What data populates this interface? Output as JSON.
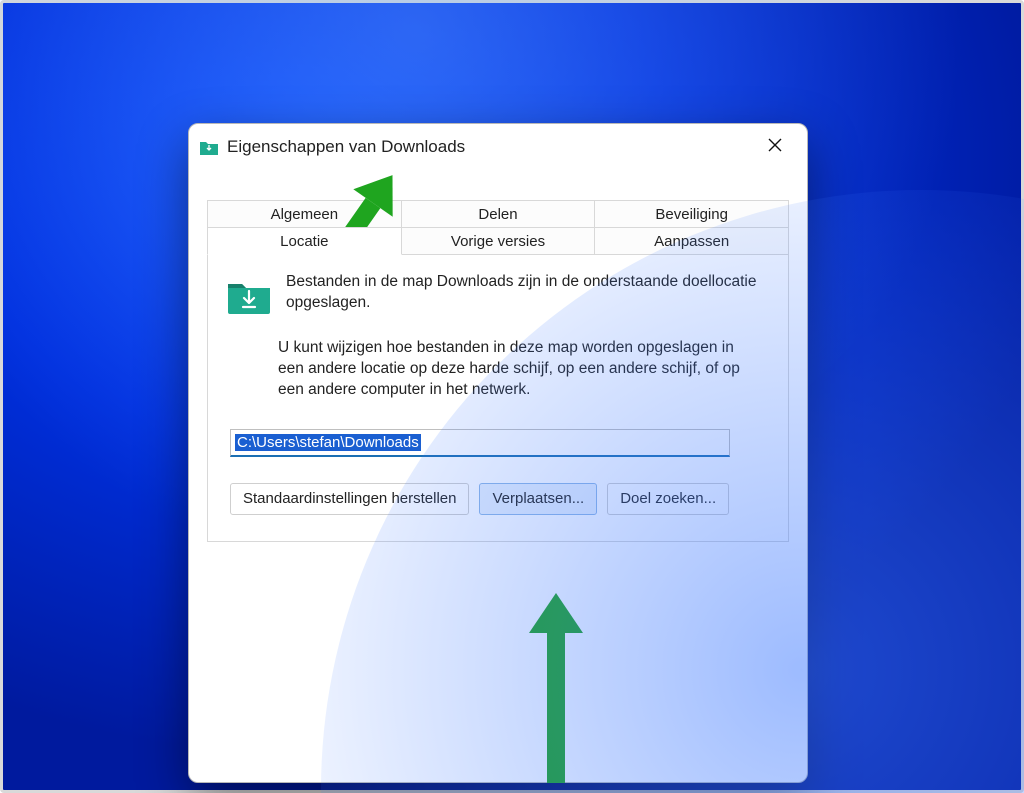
{
  "window": {
    "title": "Eigenschappen van Downloads"
  },
  "tabs": {
    "row1": [
      "Algemeen",
      "Delen",
      "Beveiliging"
    ],
    "row2": [
      "Locatie",
      "Vorige versies",
      "Aanpassen"
    ],
    "active": "Locatie"
  },
  "content": {
    "description": "Bestanden in de map Downloads zijn in de onderstaande doellocatie opgeslagen.",
    "help": "U kunt wijzigen hoe bestanden in deze map worden opgeslagen in een andere locatie op deze harde schijf, op een andere schijf, of op een andere computer in het netwerk.",
    "path": "C:\\Users\\stefan\\Downloads"
  },
  "buttons": {
    "restore": "Standaardinstellingen herstellen",
    "move": "Verplaatsen...",
    "find": "Doel zoeken..."
  },
  "colors": {
    "annotation": "#1fa51f"
  }
}
